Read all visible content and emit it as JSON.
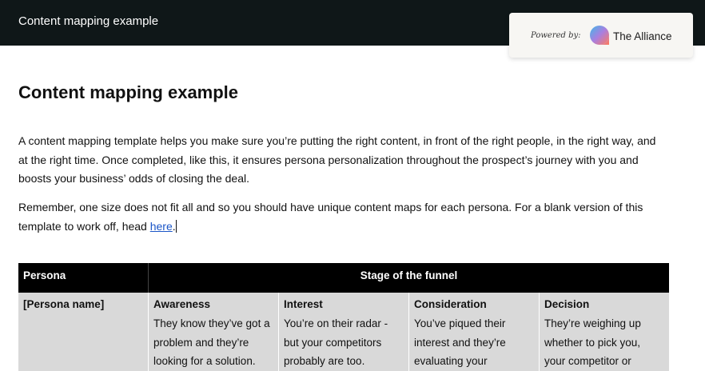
{
  "topbar": {
    "title": "Content mapping example"
  },
  "powered": {
    "label": "Powered by:",
    "brand": "The Alliance"
  },
  "page": {
    "title": "Content mapping example",
    "paragraph1": "A content mapping template helps you make sure you’re putting the right content, in front of the right people, in the right way, and at the right time. Once completed, like this, it ensures persona personalization throughout the prospect’s journey with you and boosts your business’ odds of closing the deal.",
    "paragraph2_before": "Remember, one size does not fit all and so you should have unique content maps for each persona. For a blank version of this template to work off, head ",
    "paragraph2_link": "here",
    "paragraph2_after": "."
  },
  "table": {
    "headers": {
      "persona": "Persona",
      "stage": "Stage of the funnel"
    },
    "row": {
      "persona": "[Persona name]",
      "stages": [
        {
          "title": "Awareness",
          "text": "They know they’ve got a problem and they’re looking for a solution."
        },
        {
          "title": "Interest",
          "text": "You’re on their radar - but your competitors probably are too."
        },
        {
          "title": "Consideration",
          "text": "You’ve piqued their interest and they’re evaluating your"
        },
        {
          "title": "Decision",
          "text": "They’re weighing up whether to pick you, your competitor or"
        }
      ]
    }
  },
  "colors": {
    "topbar_bg": "#0f1718",
    "link": "#1a55c7",
    "table_header_bg": "#000000",
    "table_body_bg": "#d9d9d9"
  },
  "icons": {
    "brand_logo": "alliance-logo-icon"
  }
}
